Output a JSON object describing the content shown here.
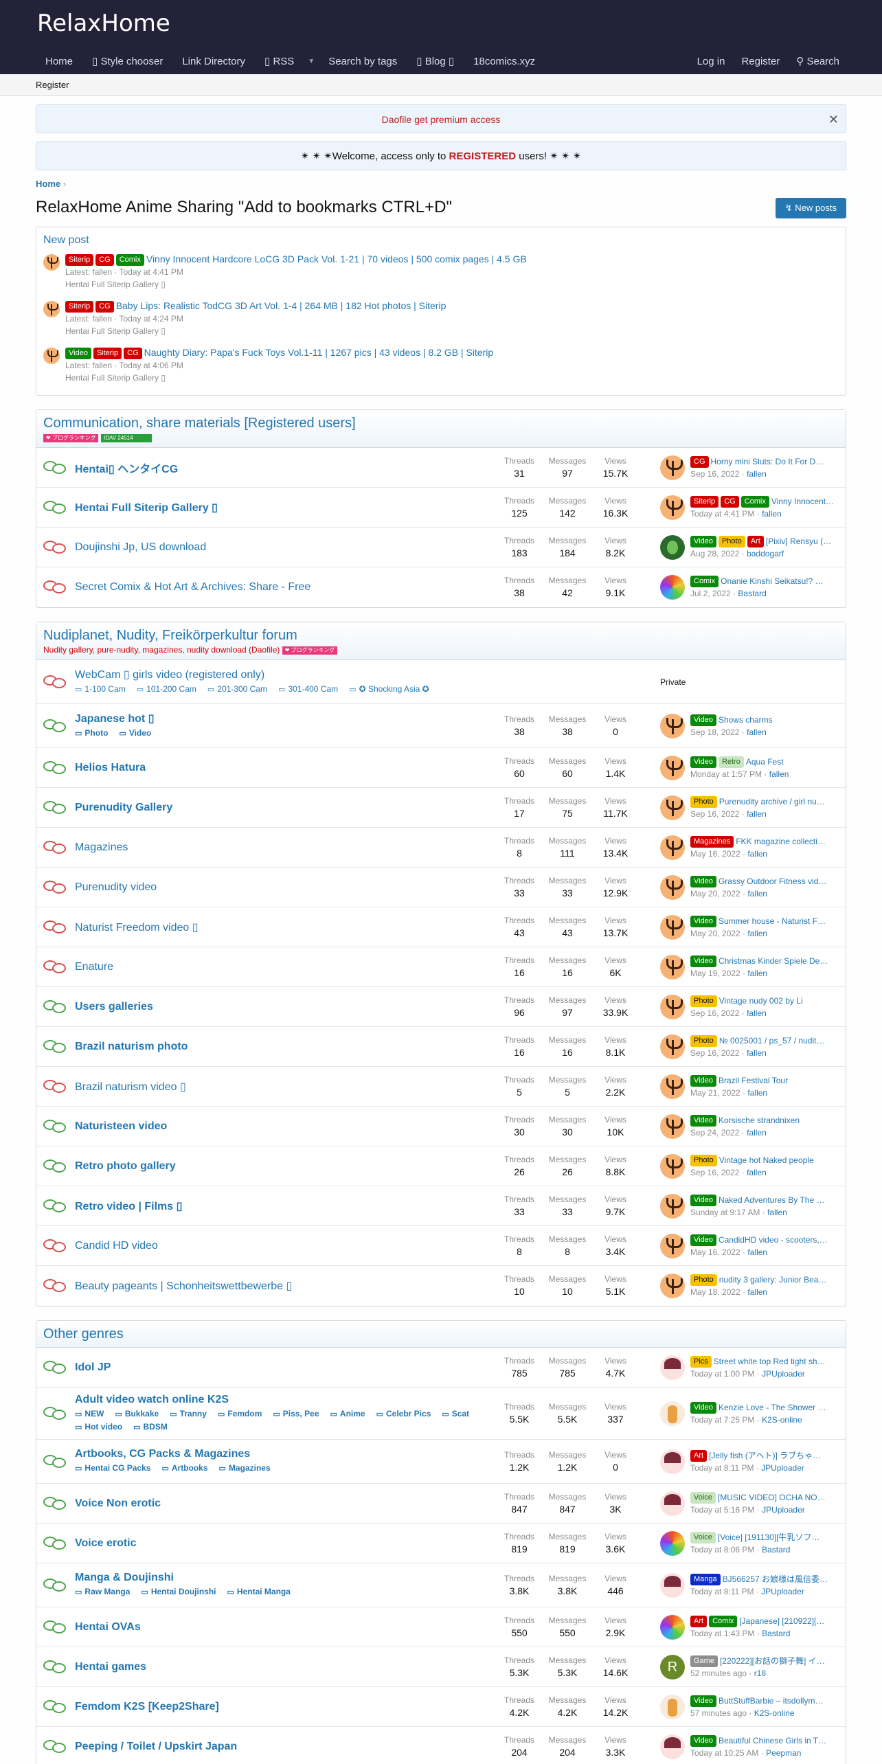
{
  "site": {
    "logo": "RelaxHome"
  },
  "nav": {
    "items": [
      "Home",
      "▯ Style chooser",
      "Link Directory",
      "▯ RSS",
      "Search by tags",
      "▯ Blog ▯",
      "18comics.xyz"
    ],
    "right": [
      "Log in",
      "Register"
    ],
    "search": "Search",
    "sub": "Register"
  },
  "notices": {
    "premium": "Daofile get premium access",
    "welcome_pre": "✴ ✴ ✴Welcome, access only to ",
    "welcome_bold": "REGISTERED",
    "welcome_post": " users! ✴ ✴ ✴"
  },
  "breadcrumb": "Home",
  "page_title": "RelaxHome Anime Sharing \"Add to bookmarks CTRL+D\"",
  "new_posts_button": "New posts",
  "new_post": {
    "heading": "New post",
    "items": [
      {
        "labels": [
          "Siterip",
          "CG",
          "Comix"
        ],
        "title": "Vinny Innocent Hardcore LoCG 3D Pack Vol. 1-21 | 70 videos | 500 comix pages | 4.5 GB",
        "meta": "Latest: fallen · Today at 4:41 PM",
        "forum": "Hentai Full Siterip Gallery ▯"
      },
      {
        "labels": [
          "Siterip",
          "CG"
        ],
        "title": "Baby Lips: Realistic TodCG 3D Art Vol. 1-4 | 264 MB | 182 Hot photos | Siterip",
        "meta": "Latest: fallen · Today at 4:24 PM",
        "forum": "Hentai Full Siterip Gallery ▯"
      },
      {
        "labels": [
          "Video",
          "Siterip",
          "CG"
        ],
        "title": "Naughty Diary: Papa's Fuck Toys Vol.1-11 | 1267 pics | 43 videos | 8.2 GB | Siterip",
        "meta": "Latest: fallen · Today at 4:06 PM",
        "forum": "Hentai Full Siterip Gallery ▯"
      }
    ]
  },
  "stat_labels": {
    "threads": "Threads",
    "messages": "Messages",
    "views": "Views"
  },
  "categories": [
    {
      "title": "Communication, share materials [Registered users]",
      "desc": "",
      "banners": [
        "❤ プログランキング",
        "IDAV 24514"
      ],
      "forums": [
        {
          "name": "Hentai▯ ヘンタイCG",
          "bold": true,
          "icon": "green",
          "threads": "31",
          "messages": "97",
          "views": "15.7K",
          "labels": [
            "CG"
          ],
          "last": "Horny mini Sluts: Do It For D…",
          "date": "Sep 16, 2022",
          "user": "fallen",
          "avatar": "orange"
        },
        {
          "name": "Hentai Full Siterip Gallery ▯",
          "bold": true,
          "icon": "green",
          "threads": "125",
          "messages": "142",
          "views": "16.3K",
          "labels": [
            "Siterip",
            "CG",
            "Comix"
          ],
          "last": "Vinny Innocent…",
          "date": "Today at 4:41 PM",
          "user": "fallen",
          "avatar": "orange"
        },
        {
          "name": "Doujinshi Jp, US download",
          "bold": false,
          "icon": "red",
          "threads": "183",
          "messages": "184",
          "views": "8.2K",
          "labels": [
            "Video",
            "Photo",
            "Art"
          ],
          "last": "[Pixiv] Rensyu (…",
          "date": "Aug 28, 2022",
          "user": "baddogarf",
          "avatar": "green"
        },
        {
          "name": "Secret Comix & Hot Art & Archives: Share - Free",
          "bold": false,
          "icon": "red",
          "threads": "38",
          "messages": "42",
          "views": "9.1K",
          "labels": [
            "Comix"
          ],
          "last": "Onanie Kinshi Seikatsu!? …",
          "date": "Jul 2, 2022",
          "user": "Bastard",
          "avatar": "rainbow"
        }
      ]
    },
    {
      "title": "Nudiplanet, Nudity, Freikörperkultur forum",
      "desc": "Nudity gallery, pure-nudity, magazines, nudity download (Daofile)",
      "banners": [
        "❤ プログランキング"
      ],
      "forums": [
        {
          "name": "WebCam ▯ girls video (registered only)",
          "bold": false,
          "icon": "red",
          "subs": [
            "1-100 Cam",
            "101-200 Cam",
            "201-300 Cam",
            "301-400 Cam",
            "✪ Shocking Asia ✪"
          ],
          "private": "Private"
        },
        {
          "name": "Japanese hot ▯",
          "bold": true,
          "icon": "green",
          "subs": [
            "Photo",
            "Video"
          ],
          "subsbold": true,
          "threads": "38",
          "messages": "38",
          "views": "0",
          "labels": [
            "Video"
          ],
          "last": "Shows charms",
          "date": "Sep 18, 2022",
          "user": "fallen",
          "avatar": "orange"
        },
        {
          "name": "Helios Hatura",
          "bold": true,
          "icon": "green",
          "threads": "60",
          "messages": "60",
          "views": "1.4K",
          "labels": [
            "Video",
            "Retro"
          ],
          "last": "Aqua Fest",
          "date": "Monday at 1:57 PM",
          "user": "fallen",
          "avatar": "orange"
        },
        {
          "name": "Purenudity Gallery",
          "bold": true,
          "icon": "green",
          "threads": "17",
          "messages": "75",
          "views": "11.7K",
          "labels": [
            "Photo"
          ],
          "last": "Purenudity archive / girl nu…",
          "date": "Sep 16, 2022",
          "user": "fallen",
          "avatar": "orange"
        },
        {
          "name": "Magazines",
          "bold": false,
          "icon": "red",
          "threads": "8",
          "messages": "111",
          "views": "13.4K",
          "labels": [
            "Magazines"
          ],
          "last": "FKK magazine collecti…",
          "date": "May 16, 2022",
          "user": "fallen",
          "avatar": "orange"
        },
        {
          "name": "Purenudity video",
          "bold": false,
          "icon": "red",
          "threads": "33",
          "messages": "33",
          "views": "12.9K",
          "labels": [
            "Video"
          ],
          "last": "Grassy Outdoor Fitness vid…",
          "date": "May 20, 2022",
          "user": "fallen",
          "avatar": "orange"
        },
        {
          "name": "Naturist Freedom video ▯",
          "bold": false,
          "icon": "red",
          "threads": "43",
          "messages": "43",
          "views": "13.7K",
          "labels": [
            "Video"
          ],
          "last": "Summer house - Naturist F…",
          "date": "May 20, 2022",
          "user": "fallen",
          "avatar": "orange"
        },
        {
          "name": "Enature",
          "bold": false,
          "icon": "red",
          "threads": "16",
          "messages": "16",
          "views": "6K",
          "labels": [
            "Video"
          ],
          "last": "Christmas Kinder Spiele De…",
          "date": "May 19, 2022",
          "user": "fallen",
          "avatar": "orange"
        },
        {
          "name": "Users galleries",
          "bold": true,
          "icon": "green",
          "threads": "96",
          "messages": "97",
          "views": "33.9K",
          "labels": [
            "Photo"
          ],
          "last": "Vintage nudy 002 by Li",
          "date": "Sep 16, 2022",
          "user": "fallen",
          "avatar": "orange"
        },
        {
          "name": "Brazil naturism photo",
          "bold": true,
          "icon": "green",
          "threads": "16",
          "messages": "16",
          "views": "8.1K",
          "labels": [
            "Photo"
          ],
          "last": "№ 0025001 / ps_57 / nudit…",
          "date": "Sep 16, 2022",
          "user": "fallen",
          "avatar": "orange"
        },
        {
          "name": "Brazil naturism video ▯",
          "bold": false,
          "icon": "red",
          "threads": "5",
          "messages": "5",
          "views": "2.2K",
          "labels": [
            "Video"
          ],
          "last": "Brazil Festival Tour",
          "date": "May 21, 2022",
          "user": "fallen",
          "avatar": "orange"
        },
        {
          "name": "Naturisteen video",
          "bold": true,
          "icon": "green",
          "threads": "30",
          "messages": "30",
          "views": "10K",
          "labels": [
            "Video"
          ],
          "last": "Korsische strandnixen",
          "date": "Sep 24, 2022",
          "user": "fallen",
          "avatar": "orange"
        },
        {
          "name": "Retro photo gallery",
          "bold": true,
          "icon": "green",
          "threads": "26",
          "messages": "26",
          "views": "8.8K",
          "labels": [
            "Photo"
          ],
          "last": "Vintage hot Naked people",
          "date": "Sep 16, 2022",
          "user": "fallen",
          "avatar": "orange"
        },
        {
          "name": "Retro video | Films ▯",
          "bold": true,
          "icon": "green",
          "threads": "33",
          "messages": "33",
          "views": "9.7K",
          "labels": [
            "Video"
          ],
          "last": "Naked Adventures By The …",
          "date": "Sunday at 9:17 AM",
          "user": "fallen",
          "avatar": "orange"
        },
        {
          "name": "Candid HD video",
          "bold": false,
          "icon": "red",
          "threads": "8",
          "messages": "8",
          "views": "3.4K",
          "labels": [
            "Video"
          ],
          "last": "CandidHD video - scooters,…",
          "date": "May 16, 2022",
          "user": "fallen",
          "avatar": "orange"
        },
        {
          "name": "Beauty pageants | Schonheitswettbewerbe ▯",
          "bold": false,
          "icon": "red",
          "threads": "10",
          "messages": "10",
          "views": "5.1K",
          "labels": [
            "Photo"
          ],
          "last": "nudity 3 gallery: Junior Bea…",
          "date": "May 18, 2022",
          "user": "fallen",
          "avatar": "orange"
        }
      ]
    },
    {
      "title": "Other genres",
      "desc": "",
      "banners": [],
      "forums": [
        {
          "name": "Idol JP",
          "bold": true,
          "icon": "green",
          "threads": "785",
          "messages": "785",
          "views": "4.7K",
          "labels": [
            "Pics"
          ],
          "last": "Street white top Red tight sh…",
          "date": "Today at 1:00 PM",
          "user": "JPUploader",
          "avatar": "anime"
        },
        {
          "name": "Adult video watch online K2S",
          "bold": true,
          "icon": "green",
          "subs": [
            "NEW",
            "Bukkake",
            "Tranny",
            "Femdom",
            "Piss, Pee",
            "Anime",
            "Celebr Pics",
            "Scat",
            "Hot video",
            "BDSM"
          ],
          "subsbold": true,
          "threads": "5.5K",
          "messages": "5.5K",
          "views": "337",
          "labels": [
            "Video"
          ],
          "last": "Kenzie Love - The Shower …",
          "date": "Today at 7:25 PM",
          "user": "K2S-online",
          "avatar": "doll"
        },
        {
          "name": "Artbooks, CG Packs & Magazines",
          "bold": true,
          "icon": "green",
          "subs": [
            "Hentai CG Packs",
            "Artbooks",
            "Magazines"
          ],
          "subsbold": true,
          "threads": "1.2K",
          "messages": "1.2K",
          "views": "0",
          "labels": [
            "Art"
          ],
          "last": "[Jelly fish (アヘト)] ラブちゃ…",
          "date": "Today at 8:11 PM",
          "user": "JPUploader",
          "avatar": "anime"
        },
        {
          "name": "Voice Non erotic",
          "bold": true,
          "icon": "green",
          "threads": "847",
          "messages": "847",
          "views": "3K",
          "labels": [
            "Voice"
          ],
          "last": "[MUSIC VIDEO] OCHA NO…",
          "date": "Today at 5:16 PM",
          "user": "JPUploader",
          "avatar": "anime"
        },
        {
          "name": "Voice erotic",
          "bold": true,
          "icon": "green",
          "threads": "819",
          "messages": "819",
          "views": "3.6K",
          "labels": [
            "Voice"
          ],
          "last": "[Voice] [191130][牛乳ソフ…",
          "date": "Today at 8:06 PM",
          "user": "Bastard",
          "avatar": "rainbow"
        },
        {
          "name": "Manga & Doujinshi",
          "bold": true,
          "icon": "green",
          "subs": [
            "Raw Manga",
            "Hentai Doujinshi",
            "Hentai Manga"
          ],
          "subsbold": true,
          "threads": "3.8K",
          "messages": "3.8K",
          "views": "446",
          "labels": [
            "Manga"
          ],
          "last": "BJ566257 お娘様は風信委…",
          "date": "Today at 8:11 PM",
          "user": "JPUploader",
          "avatar": "anime"
        },
        {
          "name": "Hentai OVAs",
          "bold": true,
          "icon": "green",
          "threads": "550",
          "messages": "550",
          "views": "2.9K",
          "labels": [
            "Art",
            "Comix"
          ],
          "last": "[Japanese] [210922][…",
          "date": "Today at 1:43 PM",
          "user": "Bastard",
          "avatar": "rainbow"
        },
        {
          "name": "Hentai games",
          "bold": true,
          "icon": "green",
          "threads": "5.3K",
          "messages": "5.3K",
          "views": "14.6K",
          "labels": [
            "Game"
          ],
          "last": "[220222][お話の獅子舞] イ…",
          "date": "52 minutes ago",
          "user": "r18",
          "avatar": "r"
        },
        {
          "name": "Femdom K2S [Keep2Share]",
          "bold": true,
          "icon": "green",
          "threads": "4.2K",
          "messages": "4.2K",
          "views": "14.2K",
          "labels": [
            "Video"
          ],
          "last": "ButtStuffBarbie – itsdollym…",
          "date": "57 minutes ago",
          "user": "K2S-online",
          "avatar": "doll"
        },
        {
          "name": "Peeping / Toilet / Upskirt Japan",
          "bold": true,
          "icon": "green",
          "threads": "204",
          "messages": "204",
          "views": "3.3K",
          "labels": [
            "Video"
          ],
          "last": "Beautiful Chinese Girls in T…",
          "date": "Today at 10:25 AM",
          "user": "Peepman",
          "avatar": "anime"
        }
      ]
    }
  ],
  "label_colors": {
    "Siterip": "lr",
    "CG": "lr",
    "Comix": "lg",
    "Video": "lg",
    "Photo": "ly",
    "Art": "lr",
    "Retro": "lgr",
    "Magazines": "lr",
    "Pics": "ly",
    "Voice": "lgr",
    "Manga": "lbl",
    "Game": "lgy"
  }
}
